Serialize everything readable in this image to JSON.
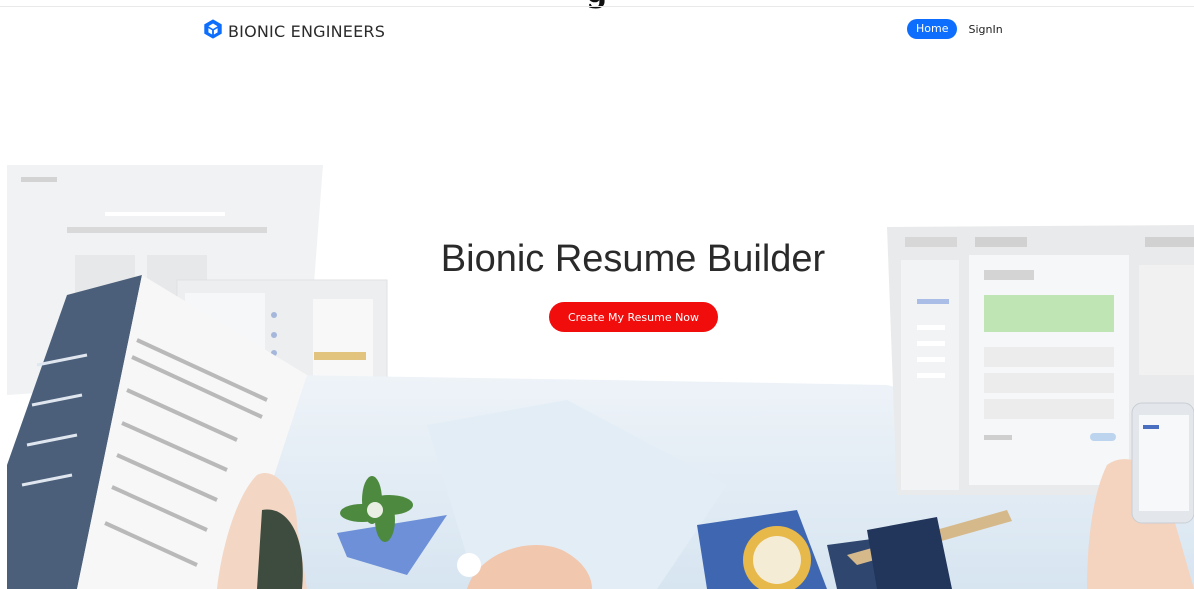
{
  "top_heading_fragment": "g",
  "brand": {
    "name": "BIONIC ENGINEERS",
    "logo_icon": "hexagon-cube-icon",
    "color": "#0d6efd"
  },
  "nav": {
    "items": [
      {
        "label": "Home",
        "active": true
      },
      {
        "label": "SignIn",
        "active": false
      }
    ]
  },
  "hero": {
    "title": "Bionic Resume Builder",
    "cta_label": "Create My Resume Now",
    "cta_color": "#f20d0d"
  }
}
